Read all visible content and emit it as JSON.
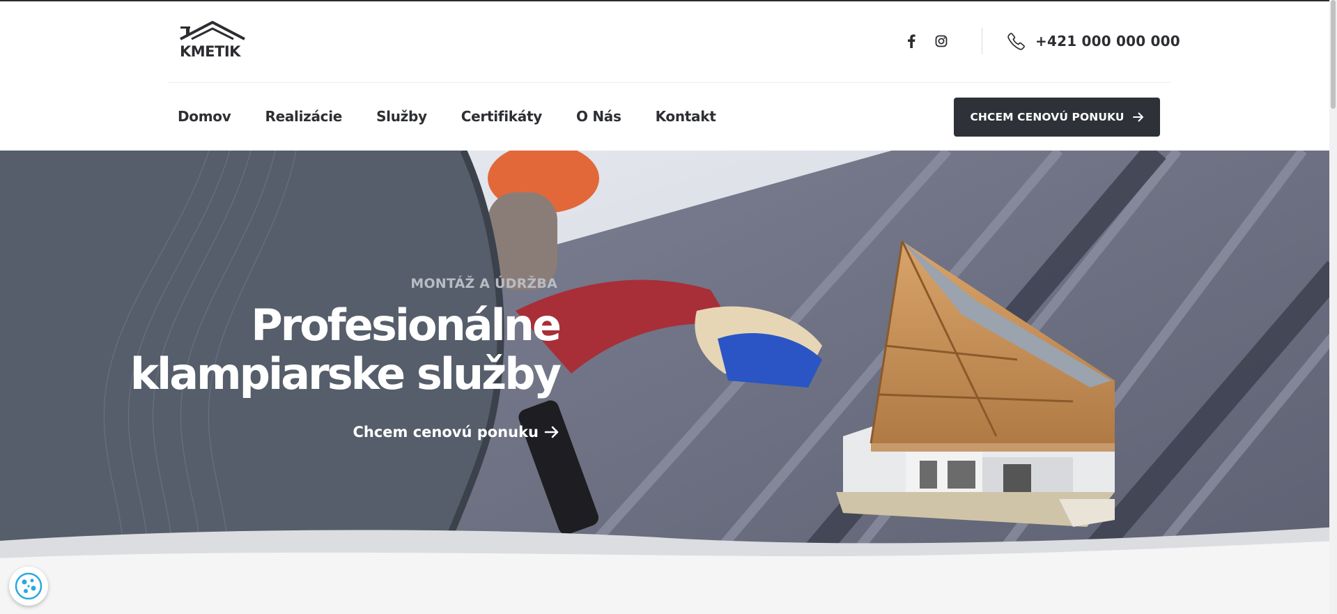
{
  "brand": {
    "logo_text": "KMETIK"
  },
  "header": {
    "social": [
      {
        "icon": "facebook-icon"
      },
      {
        "icon": "instagram-icon"
      }
    ],
    "phone": "+421 000 000 000",
    "cta_label": "CHCEM CENOVÚ PONUKU"
  },
  "nav": {
    "items": [
      {
        "label": "Domov"
      },
      {
        "label": "Realizácie"
      },
      {
        "label": "Služby"
      },
      {
        "label": "Certifikáty"
      },
      {
        "label": "O Nás"
      },
      {
        "label": "Kontakt"
      }
    ]
  },
  "hero": {
    "eyebrow": "MONTÁŽ A ÚDRŽBA",
    "title_line1": "Profesionálne",
    "title_line2": "klampiarske služby",
    "link_label": "Chcem cenovú ponuku"
  },
  "colors": {
    "dark": "#2e3137",
    "panel": "#555e6a",
    "accent_blue": "#29a8e0"
  }
}
